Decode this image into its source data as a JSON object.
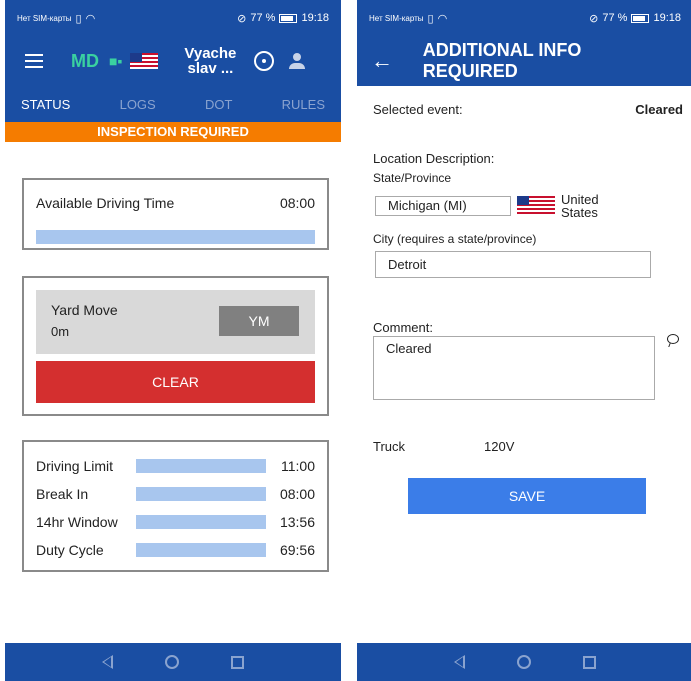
{
  "status_bar": {
    "carrier": "Нет SIM-карты",
    "battery": "77 %",
    "time": "19:18"
  },
  "left_screen": {
    "app_bar": {
      "mode_badge": "MD",
      "driver_name_line1": "Vyache",
      "driver_name_line2": "slav ..."
    },
    "tabs": [
      "STATUS",
      "LOGS",
      "DOT",
      "RULES"
    ],
    "active_tab": "STATUS",
    "banner": "INSPECTION REQUIRED",
    "available_driving": {
      "label": "Available Driving Time",
      "value": "08:00",
      "progress": 1.0
    },
    "yard_move": {
      "title": "Yard Move",
      "time": "0m",
      "button": "YM"
    },
    "clear_button": "CLEAR",
    "limits": [
      {
        "label": "Driving Limit",
        "value": "11:00",
        "progress": 1.0
      },
      {
        "label": "Break In",
        "value": "08:00",
        "progress": 1.0
      },
      {
        "label": "14hr Window",
        "value": "13:56",
        "progress": 1.0
      },
      {
        "label": "Duty Cycle",
        "value": "69:56",
        "progress": 1.0
      }
    ]
  },
  "right_screen": {
    "title": "ADDITIONAL INFO REQUIRED",
    "selected_event_label": "Selected event:",
    "selected_event_value": "Cleared",
    "location_description_label": "Location Description:",
    "state_label": "State/Province",
    "state_value": "Michigan (MI)",
    "country_line1": "United",
    "country_line2": "States",
    "city_label": "City (requires a state/province)",
    "city_value": "Detroit",
    "comment_label": "Comment:",
    "comment_value": "Cleared",
    "truck_label": "Truck",
    "truck_value": "120V",
    "save_button": "SAVE"
  },
  "colors": {
    "primary": "#1a4ea3",
    "banner_orange": "#f57c00",
    "clear_red": "#d42f2f",
    "save_blue": "#3b7de8",
    "bar_blue": "#a8c6ee",
    "md_green": "#3ad1a0"
  },
  "icons": [
    "menu-icon",
    "truck-icon",
    "us-flag-icon",
    "steering-wheel-icon",
    "person-icon",
    "back-arrow-icon",
    "comment-icon",
    "nav-back-icon",
    "nav-home-icon",
    "nav-recent-icon"
  ]
}
